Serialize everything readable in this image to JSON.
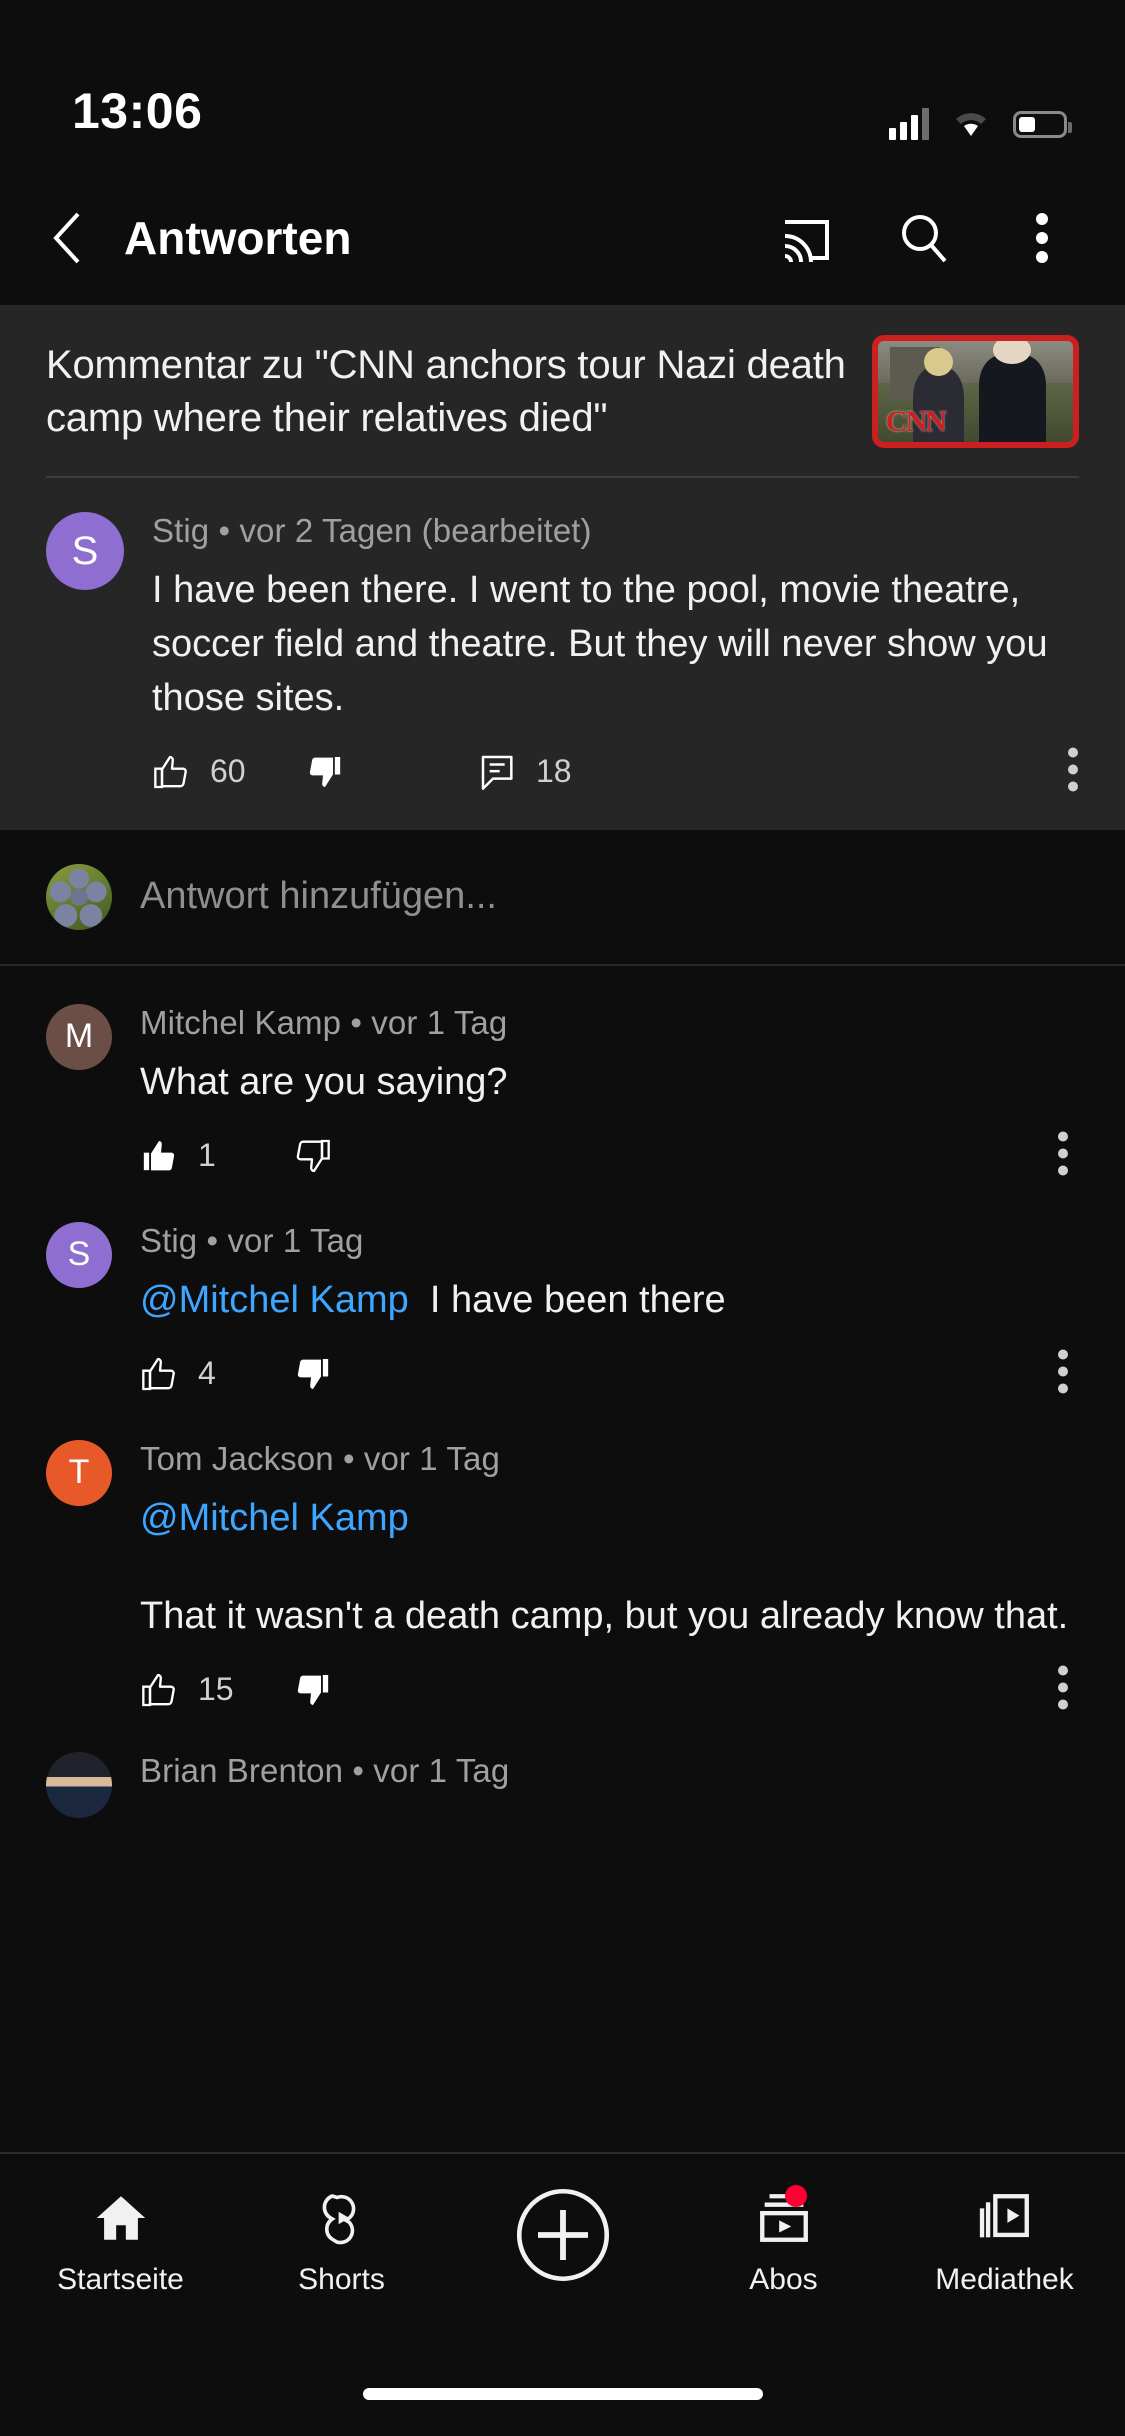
{
  "status_bar": {
    "time": "13:06",
    "signal_icon": "cellular-signal-icon",
    "wifi_icon": "wifi-icon",
    "battery_icon": "battery-icon"
  },
  "app_bar": {
    "back_icon": "back-chevron-icon",
    "title": "Antworten",
    "cast_icon": "cast-icon",
    "search_icon": "search-icon",
    "more_icon": "more-vertical-icon"
  },
  "video_header": {
    "title": "Kommentar zu \"CNN anchors tour Nazi death camp where their relatives died\"",
    "thumbnail_label": "CNN",
    "thumbnail_border_color": "#cc1f1f"
  },
  "top_comment": {
    "author": "Stig",
    "meta": "Stig • vor 2 Tagen (bearbeitet)",
    "avatar_letter": "S",
    "avatar_color": "#8e6fd1",
    "text": "I have been there. I went to the pool, movie theatre, soccer field and theatre. But they will never show you those sites.",
    "like_icon": "thumbs-up-outline-icon",
    "like_count": "60",
    "dislike_icon": "thumbs-down-filled-icon",
    "reply_icon": "comment-bubble-icon",
    "reply_count": "18",
    "more_icon": "more-vertical-icon"
  },
  "reply_composer": {
    "avatar_icon": "user-avatar-flower",
    "placeholder": "Antwort hinzufügen..."
  },
  "replies": [
    {
      "author": "Mitchel Kamp",
      "meta": "Mitchel Kamp • vor 1 Tag",
      "avatar_letter": "M",
      "avatar_color": "#6b4e45",
      "mention": "",
      "text": "What are you saying?",
      "like_icon": "thumbs-up-filled-icon",
      "like_count": "1",
      "dislike_icon": "thumbs-down-outline-icon",
      "more_icon": "more-vertical-icon"
    },
    {
      "author": "Stig",
      "meta": "Stig • vor 1 Tag",
      "avatar_letter": "S",
      "avatar_color": "#8e6fd1",
      "mention": "@Mitchel Kamp",
      "text": "I have been there",
      "like_icon": "thumbs-up-outline-icon",
      "like_count": "4",
      "dislike_icon": "thumbs-down-filled-icon",
      "more_icon": "more-vertical-icon"
    },
    {
      "author": "Tom Jackson",
      "meta": "Tom Jackson • vor 1 Tag",
      "avatar_letter": "T",
      "avatar_color": "#e8592a",
      "mention": "@Mitchel Kamp",
      "text": "That it wasn't a death camp, but you already know that.",
      "like_icon": "thumbs-up-outline-icon",
      "like_count": "15",
      "dislike_icon": "thumbs-down-filled-icon",
      "more_icon": "more-vertical-icon"
    },
    {
      "author": "Brian Brenton",
      "meta": "Brian Brenton • vor 1 Tag",
      "avatar_letter": "",
      "avatar_color": "#3b4a63",
      "mention": "",
      "text": "",
      "like_icon": "",
      "like_count": "",
      "dislike_icon": "",
      "more_icon": ""
    }
  ],
  "bottom_nav": [
    {
      "label": "Startseite",
      "icon": "home-icon",
      "badge": false
    },
    {
      "label": "Shorts",
      "icon": "shorts-icon",
      "badge": false
    },
    {
      "label": "",
      "icon": "create-plus-icon",
      "badge": false
    },
    {
      "label": "Abos",
      "icon": "subscriptions-icon",
      "badge": true
    },
    {
      "label": "Mediathek",
      "icon": "library-icon",
      "badge": false
    }
  ],
  "accent_colors": {
    "mention_blue": "#3ea6ff",
    "badge_red": "#ff0033",
    "surface": "#262626",
    "background": "#0d0d0d"
  }
}
